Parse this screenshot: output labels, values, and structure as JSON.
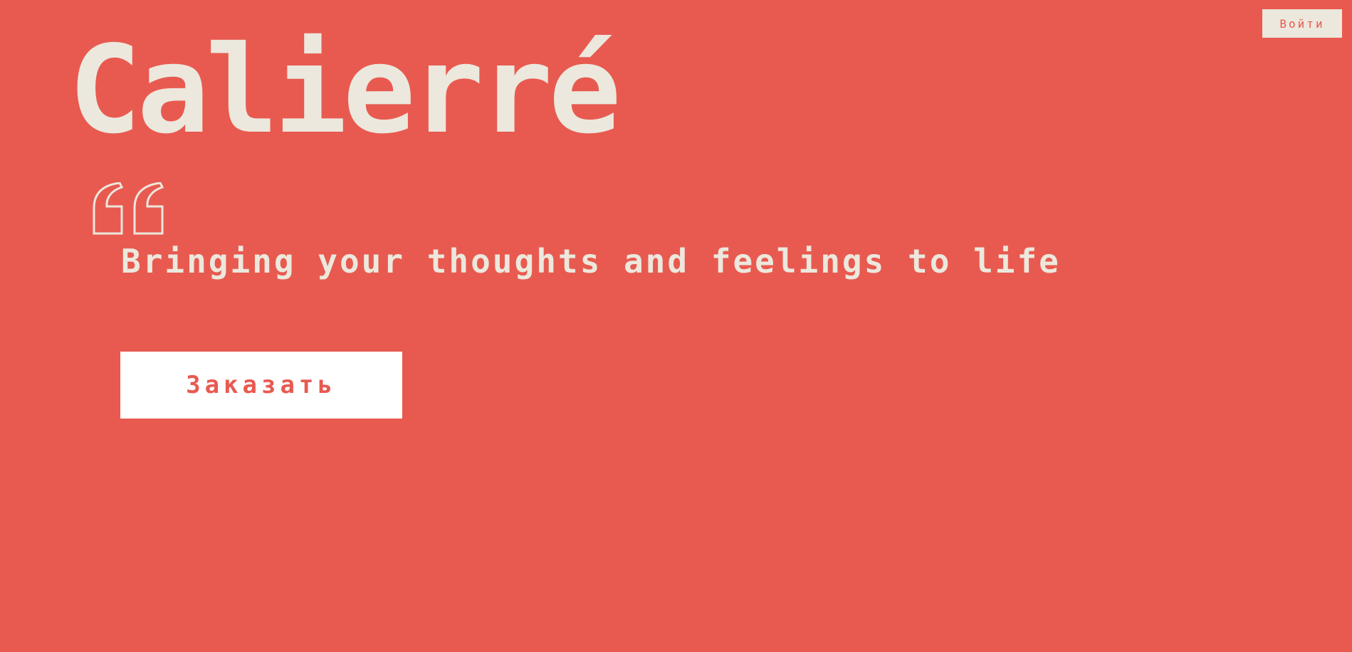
{
  "header": {
    "login_label": "Войти"
  },
  "hero": {
    "brand": "Calierré",
    "tagline": "Bringing your thoughts and feelings to life",
    "order_label": "Заказать"
  },
  "icons": {
    "quote": "quote-open-icon"
  },
  "colors": {
    "background": "#e85a50",
    "text": "#ece8dd",
    "button_white": "#ffffff",
    "accent": "#e85a50"
  }
}
